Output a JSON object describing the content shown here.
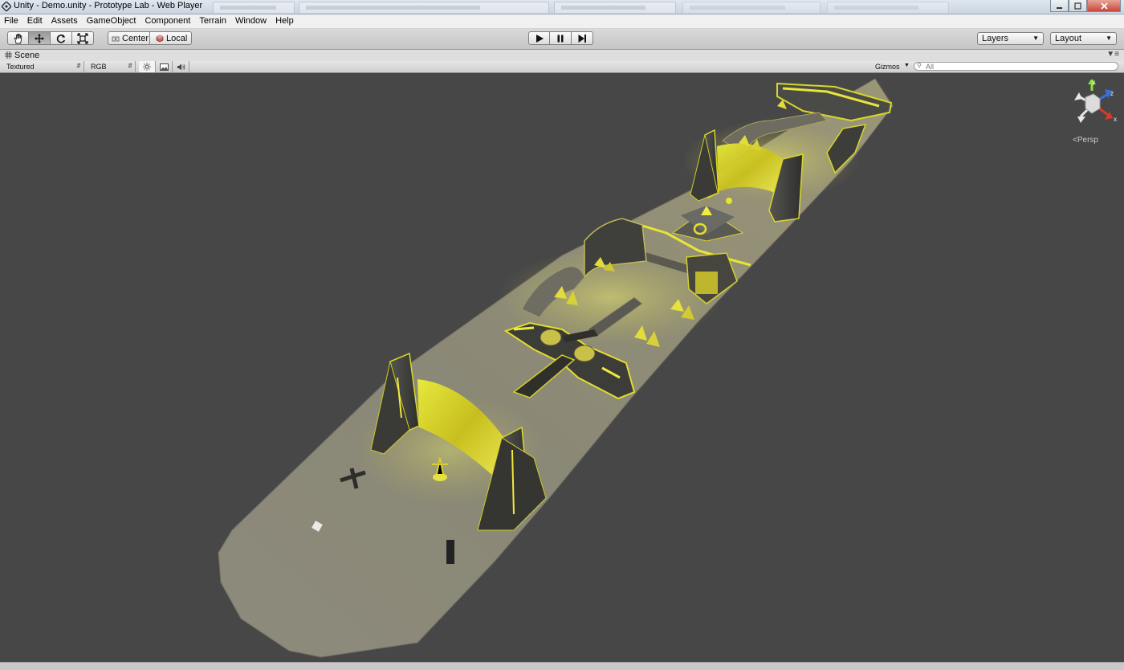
{
  "window": {
    "title": "Unity - Demo.unity - Prototype Lab - Web Player",
    "controls": [
      "minimize",
      "maximize",
      "close"
    ]
  },
  "menu": {
    "items": [
      "File",
      "Edit",
      "Assets",
      "GameObject",
      "Component",
      "Terrain",
      "Window",
      "Help"
    ]
  },
  "toolbar": {
    "transform_tools": [
      {
        "name": "hand-tool",
        "icon": "hand-icon",
        "active": false
      },
      {
        "name": "move-tool",
        "icon": "move-arrows-icon",
        "active": true
      },
      {
        "name": "rotate-tool",
        "icon": "rotate-icon",
        "active": false
      },
      {
        "name": "scale-tool",
        "icon": "scale-icon",
        "active": false
      }
    ],
    "pivot_mode": "Center",
    "pivot_rotation": "Local",
    "playback": [
      "play-icon",
      "pause-icon",
      "step-icon"
    ],
    "layers_label": "Layers",
    "layout_label": "Layout"
  },
  "scene": {
    "tab_label": "Scene",
    "draw_mode": "Textured",
    "render_mode": "RGB",
    "toggles": [
      "sun-lighting-icon",
      "image-effects-icon",
      "audio-icon"
    ],
    "gizmos_label": "Gizmos",
    "search_placeholder": "All",
    "projection_label": "Persp",
    "axes": {
      "y": "y",
      "z": "z",
      "x": "x"
    }
  },
  "colors": {
    "viewport_bg": "#474747",
    "ground": "#8a8774",
    "glow": "#e6e41a",
    "structure": "#3f3f3b",
    "axis_x": "#d83a2a",
    "axis_y": "#8ee03a",
    "axis_z": "#3a6fd8"
  }
}
